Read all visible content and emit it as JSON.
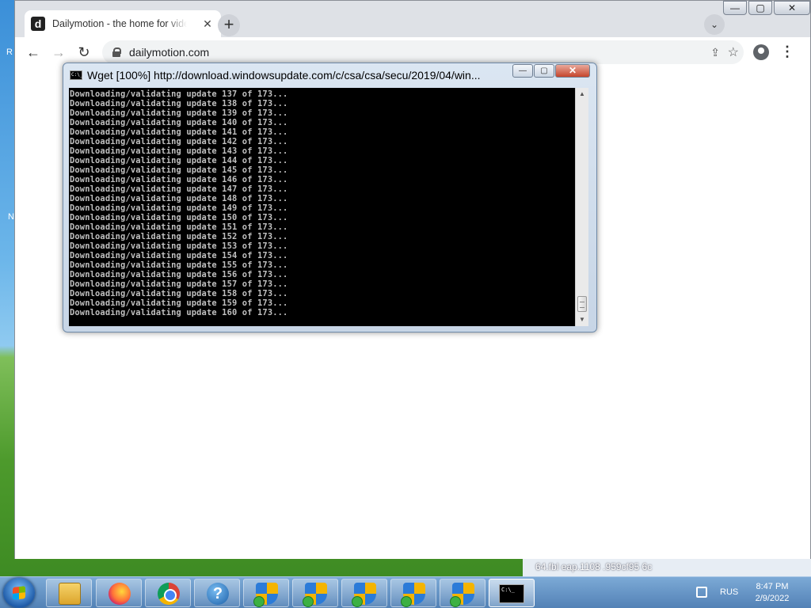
{
  "desktop": {
    "hint_r": "R",
    "hint_n": "N"
  },
  "browser": {
    "tab": {
      "favicon": "d",
      "title": "Dailymotion - the home for videos",
      "close": "✕"
    },
    "new_tab": "+",
    "tab_search": "⌄",
    "window_controls": {
      "minimize": "—",
      "maximize": "▢",
      "close": "✕"
    },
    "nav": {
      "back": "←",
      "forward": "→",
      "reload": "↻"
    },
    "address": "dailymotion.com",
    "share_icon": "⇪",
    "star_icon": "☆",
    "menu_icon": "⋮"
  },
  "cmd": {
    "title": "Wget [100%] http://download.windowsupdate.com/c/csa/csa/secu/2019/04/win...",
    "controls": {
      "minimize": "—",
      "maximize": "▢",
      "close": "✕"
    },
    "scroll_up": "▲",
    "scroll_down": "▼",
    "lines": [
      "Downloading/validating update 137 of 173...",
      "Downloading/validating update 138 of 173...",
      "Downloading/validating update 139 of 173...",
      "Downloading/validating update 140 of 173...",
      "Downloading/validating update 141 of 173...",
      "Downloading/validating update 142 of 173...",
      "Downloading/validating update 143 of 173...",
      "Downloading/validating update 144 of 173...",
      "Downloading/validating update 145 of 173...",
      "Downloading/validating update 146 of 173...",
      "Downloading/validating update 147 of 173...",
      "Downloading/validating update 148 of 173...",
      "Downloading/validating update 149 of 173...",
      "Downloading/validating update 150 of 173...",
      "Downloading/validating update 151 of 173...",
      "Downloading/validating update 152 of 173...",
      "Downloading/validating update 153 of 173...",
      "Downloading/validating update 154 of 173...",
      "Downloading/validating update 155 of 173...",
      "Downloading/validating update 156 of 173...",
      "Downloading/validating update 157 of 173...",
      "Downloading/validating update 158 of 173...",
      "Downloading/validating update 159 of 173...",
      "Downloading/validating update 160 of 173..."
    ]
  },
  "background_text": "64.fbl  eap.1108  .959cf95  6c",
  "taskbar": {
    "help_glyph": "?",
    "cmd_glyph": "C:\\_",
    "language": "RUS",
    "time": "8:47 PM",
    "date": "2/9/2022",
    "pinned": [
      "folder-icon",
      "firefox-icon",
      "chrome-icon",
      "help-icon",
      "shield-icon",
      "shield-icon",
      "shield-icon",
      "shield-icon",
      "shield-icon",
      "cmd-icon"
    ]
  }
}
